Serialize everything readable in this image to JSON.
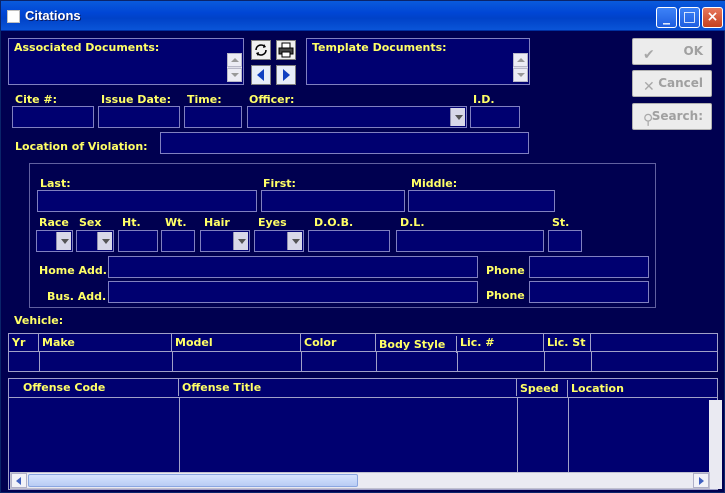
{
  "window": {
    "title": "Citations",
    "min_icon": "minimize-icon",
    "max_icon": "maximize-icon",
    "close_icon": "close-icon"
  },
  "labels": {
    "associated_documents": "Associated Documents:",
    "template_documents": "Template Documents:",
    "cite_no": "Cite #:",
    "issue_date": "Issue Date:",
    "time": "Time:",
    "officer": "Officer:",
    "id": "I.D.",
    "location_of_violation": "Location of Violation:",
    "last": "Last:",
    "first": "First:",
    "middle": "Middle:",
    "race": "Race",
    "sex": "Sex",
    "ht": "Ht.",
    "wt": "Wt.",
    "hair": "Hair",
    "eyes": "Eyes",
    "dob": "D.O.B.",
    "dl": "D.L.",
    "st": "St.",
    "home_add": "Home Add.",
    "bus_add": "Bus. Add.",
    "phone1": "Phone",
    "phone2": "Phone",
    "vehicle": "Vehicle:"
  },
  "buttons": {
    "ok": "OK",
    "cancel": "Cancel",
    "search": "Search:"
  },
  "vehicle_columns": [
    "Yr",
    "Make",
    "Model",
    "Color",
    "Body Style",
    "Lic. #",
    "Lic. St"
  ],
  "offense_columns": [
    "Offense Code",
    "Offense Title",
    "Speed",
    "Location"
  ],
  "colors": {
    "background": "#000050",
    "label": "#ffff66",
    "field": "#000070"
  }
}
